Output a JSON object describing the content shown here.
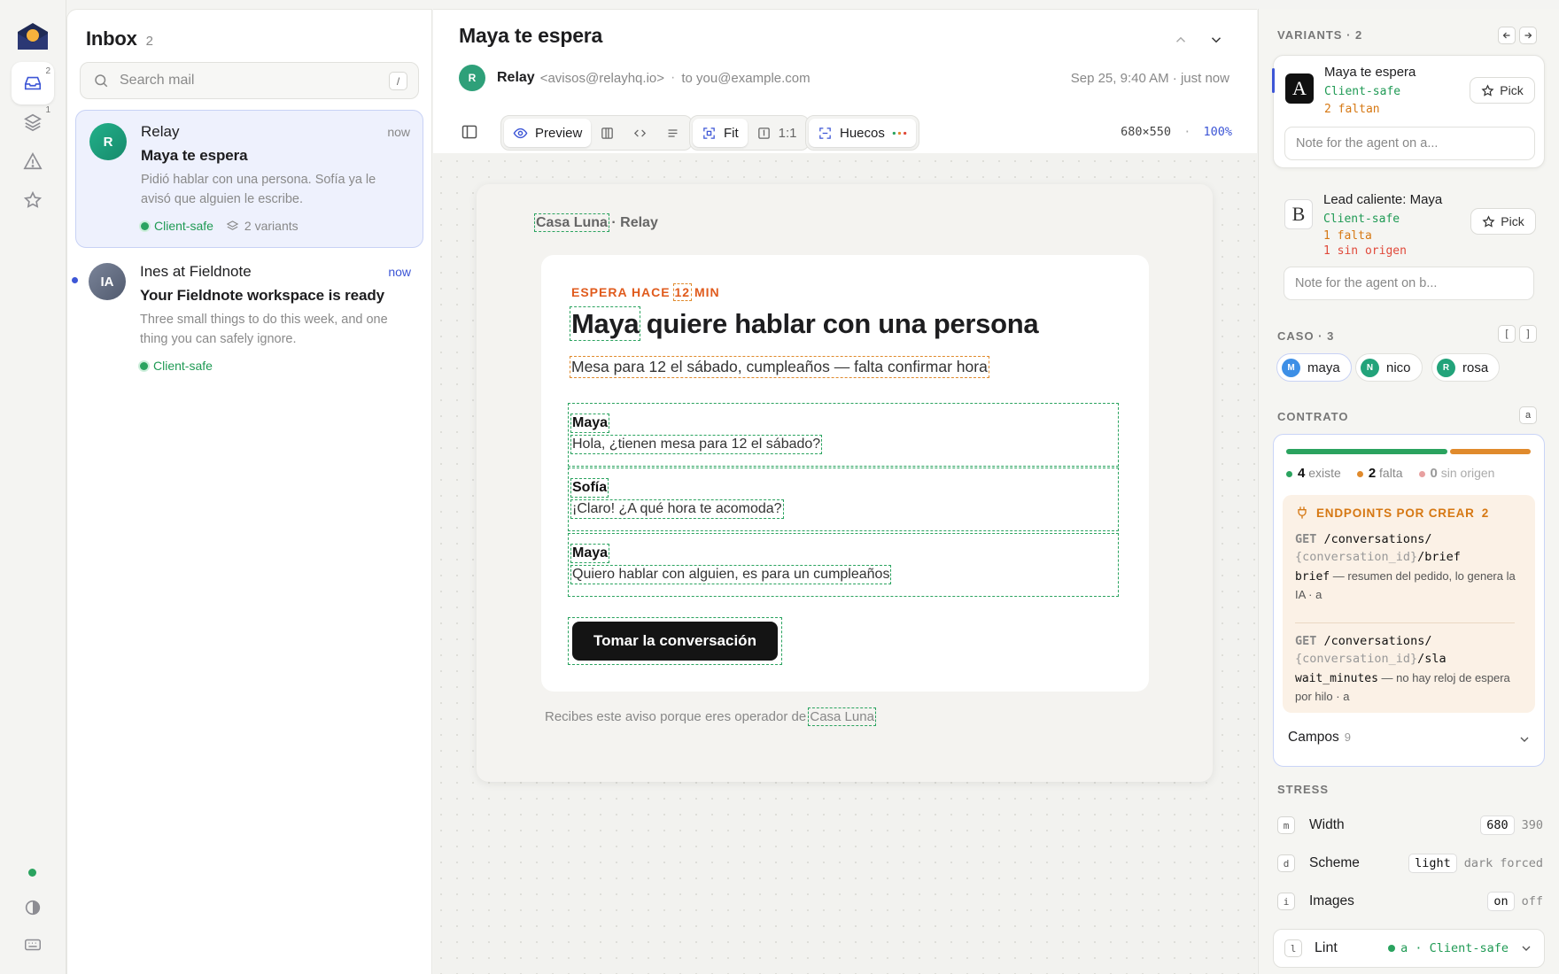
{
  "rail": {
    "inbox_badge": "2",
    "layers_badge": "1"
  },
  "inbox": {
    "title": "Inbox",
    "count": "2",
    "search_placeholder": "Search mail",
    "search_shortcut": "/",
    "mails": [
      {
        "avatar": "R",
        "from": "Relay",
        "time": "now",
        "subject": "Maya te espera",
        "preview": "Pidió hablar con una persona. Sofía ya le avisó que alguien le escribe.",
        "tag": "Client-safe",
        "variants": "2 variants"
      },
      {
        "avatar": "IA",
        "from": "Ines at Fieldnote",
        "time": "now",
        "subject": "Your Fieldnote workspace is ready",
        "preview": "Three small things to do this week, and one thing you can safely ignore.",
        "tag": "Client-safe"
      }
    ]
  },
  "message": {
    "subject": "Maya te espera",
    "sender_avatar": "R",
    "sender_name": "Relay",
    "sender_addr": "<avisos@relayhq.io>",
    "separator": "·",
    "to": "to you@example.com",
    "date": "Sep 25, 9:40 AM · just now"
  },
  "toolbar": {
    "preview": "Preview",
    "fit": "Fit",
    "one_to_one": "1:1",
    "huecos": "Huecos",
    "dims": "680×550",
    "dot_sep": "·",
    "zoom": "100%"
  },
  "email": {
    "brand": "Casa Luna",
    "brand_suffix": "· Relay",
    "eyebrow_pre": "ESPERA HACE",
    "eyebrow_num": "12",
    "eyebrow_post": "MIN",
    "headline_name": "Maya",
    "headline_rest": "quiere hablar con una persona",
    "summary": "Mesa para 12 el sábado, cumpleaños — falta confirmar hora",
    "conversation": [
      {
        "who": "Maya",
        "msg": "Hola, ¿tienen mesa para 12 el sábado?"
      },
      {
        "who": "Sofía",
        "msg": "¡Claro! ¿A qué hora te acomoda?"
      },
      {
        "who": "Maya",
        "msg": "Quiero hablar con alguien, es para un cumpleaños"
      }
    ],
    "cta": "Tomar la conversación",
    "footer_pre": "Recibes este aviso porque eres operador de",
    "footer_brand": "Casa Luna"
  },
  "variants": {
    "label": "VARIANTS · 2",
    "items": [
      {
        "letter": "A",
        "name": "Maya te espera",
        "safe": "Client-safe",
        "issue1": "2 faltan",
        "pick": "Pick",
        "note_placeholder": "Note for the agent on a..."
      },
      {
        "letter": "B",
        "name": "Lead caliente: Maya",
        "safe": "Client-safe",
        "issue1": "1 falta",
        "issue2": "1 sin origen",
        "pick": "Pick",
        "note_placeholder": "Note for the agent on b..."
      }
    ]
  },
  "caso": {
    "label": "CASO · 3",
    "key_prev": "[",
    "key_next": "]",
    "chips": [
      {
        "initial": "M",
        "name": "maya"
      },
      {
        "initial": "N",
        "name": "nico"
      },
      {
        "initial": "R",
        "name": "rosa"
      }
    ]
  },
  "contrato": {
    "label": "CONTRATO",
    "key": "a",
    "progress": {
      "existe": 4,
      "falta": 2,
      "sin_origen": 0
    },
    "legend": {
      "existe_n": "4",
      "existe": "existe",
      "falta_n": "2",
      "falta": "falta",
      "sin_n": "0",
      "sin": "sin origen"
    },
    "endpoints_title": "ENDPOINTS POR CREAR",
    "endpoints_count": "2",
    "endpoints": [
      {
        "method": "GET",
        "path1": "/conversations/",
        "param": "{conversation_id}",
        "path2": "/brief",
        "field": "brief",
        "desc": " — resumen del pedido, lo genera la IA · a"
      },
      {
        "method": "GET",
        "path1": "/conversations/",
        "param": "{conversation_id}",
        "path2": "/sla",
        "field": "wait_minutes",
        "desc": " — no hay reloj de espera por hilo · a"
      }
    ],
    "campos": "Campos",
    "campos_count": "9"
  },
  "stress": {
    "label": "STRESS",
    "rows": [
      {
        "key": "m",
        "name": "Width",
        "options": [
          "680",
          "390"
        ]
      },
      {
        "key": "d",
        "name": "Scheme",
        "options": [
          "light",
          "dark",
          "forced"
        ]
      },
      {
        "key": "i",
        "name": "Images",
        "options": [
          "on",
          "off"
        ]
      }
    ]
  },
  "lint": {
    "key": "l",
    "name": "Lint",
    "status": "a · Client-safe"
  },
  "colors": {
    "accent": "#3d56d6",
    "safe": "#2aa35f",
    "warn": "#e08a2c",
    "danger": "#e05b1d",
    "missing": "#e8a0a0"
  }
}
